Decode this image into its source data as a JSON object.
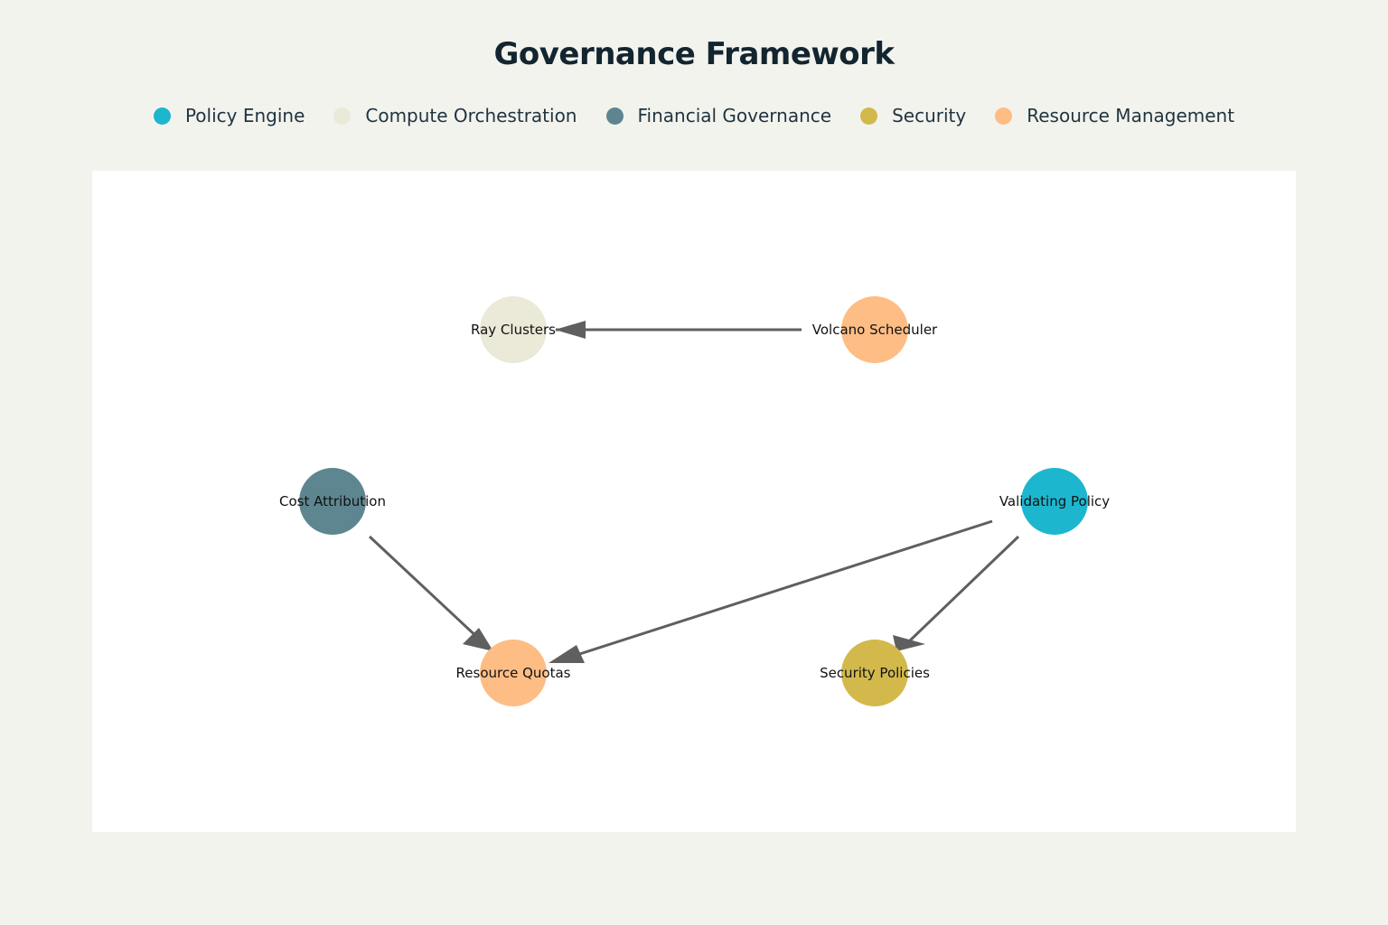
{
  "title": "Governance Framework",
  "legend": [
    {
      "name": "Policy Engine",
      "color": "#1db6cf"
    },
    {
      "name": "Compute Orchestration",
      "color": "#ebe9d7"
    },
    {
      "name": "Financial Governance",
      "color": "#5e8690"
    },
    {
      "name": "Security",
      "color": "#d3b94c"
    },
    {
      "name": "Resource Management",
      "color": "#fdbd85"
    }
  ],
  "nodes": [
    {
      "id": "ray",
      "label": "Ray Clusters",
      "group": "Compute Orchestration"
    },
    {
      "id": "volcano",
      "label": "Volcano Scheduler",
      "group": "Resource Management"
    },
    {
      "id": "cost",
      "label": "Cost Attribution",
      "group": "Financial Governance"
    },
    {
      "id": "validating",
      "label": "Validating Policy",
      "group": "Policy Engine"
    },
    {
      "id": "quotas",
      "label": "Resource Quotas",
      "group": "Resource Management"
    },
    {
      "id": "secpol",
      "label": "Security Policies",
      "group": "Security"
    }
  ],
  "edges": [
    {
      "from": "volcano",
      "to": "ray"
    },
    {
      "from": "cost",
      "to": "quotas"
    },
    {
      "from": "validating",
      "to": "quotas"
    },
    {
      "from": "validating",
      "to": "secpol"
    }
  ],
  "colors": {
    "edge": "#5f5f5f"
  }
}
